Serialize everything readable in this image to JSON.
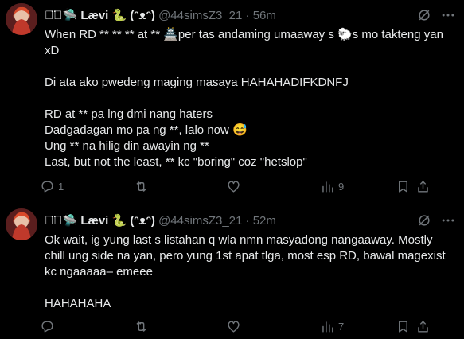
{
  "tweets": [
    {
      "display_name": "◡̈⃝🛸 Lævi 🐍 (ᵔᴥᵔ)",
      "handle": "@44simsZ3_21",
      "separator": "·",
      "time": "56m",
      "text": "When RD ** ** ** at ** 🏯per tas andaming umaaway s 🐑s mo takteng yan xD\n\nDi ata ako pwedeng maging masaya HAHAHADIFKDNFJ\n\nRD at ** pa lng dmi nang haters\nDadgadagan mo pa ng **, lalo now 😅\nUng ** na hilig din awayin ng **\nLast, but not the least, ** kc \"boring\" coz \"hetslop\"",
      "replies": "1",
      "retweets": "",
      "likes": "",
      "views": "9"
    },
    {
      "display_name": "◡̈⃝🛸 Lævi 🐍 (ᵔᴥᵔ)",
      "handle": "@44simsZ3_21",
      "separator": "·",
      "time": "52m",
      "text": "Ok wait, ig yung last s listahan q wla nmn masyadong nangaaway. Mostly chill ung side na yan, pero yung 1st apat tlga, most esp RD, bawal magexist kc ngaaaaa– emeee\n\nHAHAHAHA",
      "replies": "",
      "retweets": "",
      "likes": "",
      "views": "7"
    }
  ],
  "colors": {
    "background": "#000000",
    "text": "#e7e9ea",
    "muted": "#71767b",
    "divider": "#2f3336"
  },
  "icons": [
    "avatar",
    "grok-icon",
    "more-icon",
    "reply-icon",
    "retweet-icon",
    "like-icon",
    "views-icon",
    "bookmark-icon",
    "share-icon"
  ]
}
